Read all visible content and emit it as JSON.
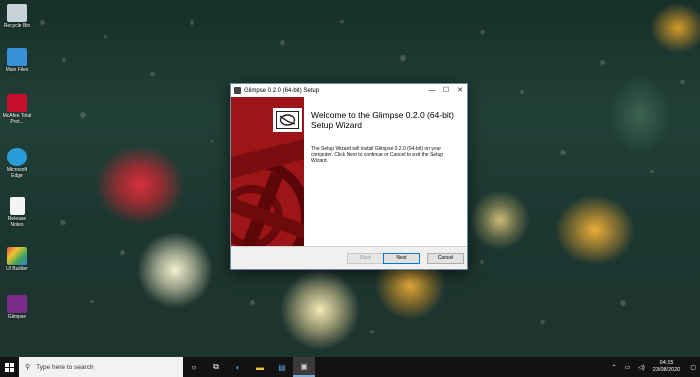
{
  "desktop": {
    "icons": [
      {
        "label": "Recycle Bin",
        "color": "#c9d3dc"
      },
      {
        "label": "Main Files",
        "color": "#3a8fd9"
      },
      {
        "label": "McAfee Total Prot...",
        "color": "#c8102e"
      },
      {
        "label": "Microsoft Edge",
        "color": "#2a9cd8"
      },
      {
        "label": "Release Notes",
        "color": "#f4f4f4"
      },
      {
        "label": "Ul Builder",
        "color": "#5d8cc2"
      },
      {
        "label": "Glimpse",
        "color": "#7a2d8a"
      }
    ]
  },
  "window": {
    "title": "Glimpse 0.2.0 (64-bit) Setup",
    "minimize": "—",
    "maximize": "☐",
    "close": "✕",
    "heading": "Welcome to the Glimpse 0.2.0 (64-bit) Setup Wizard",
    "description": "The Setup Wizard will install Glimpse 0.2.0 (64-bit) on your computer. Click Next to continue or Cancel to exit the Setup Wizard.",
    "buttons": {
      "back": "Back",
      "next": "Next",
      "cancel": "Cancel"
    },
    "sidebar_color": "#9e1517"
  },
  "taskbar": {
    "search_placeholder": "Type here to search",
    "search_icon": "search-icon",
    "time": "04:15",
    "date": "23/08/2020"
  }
}
